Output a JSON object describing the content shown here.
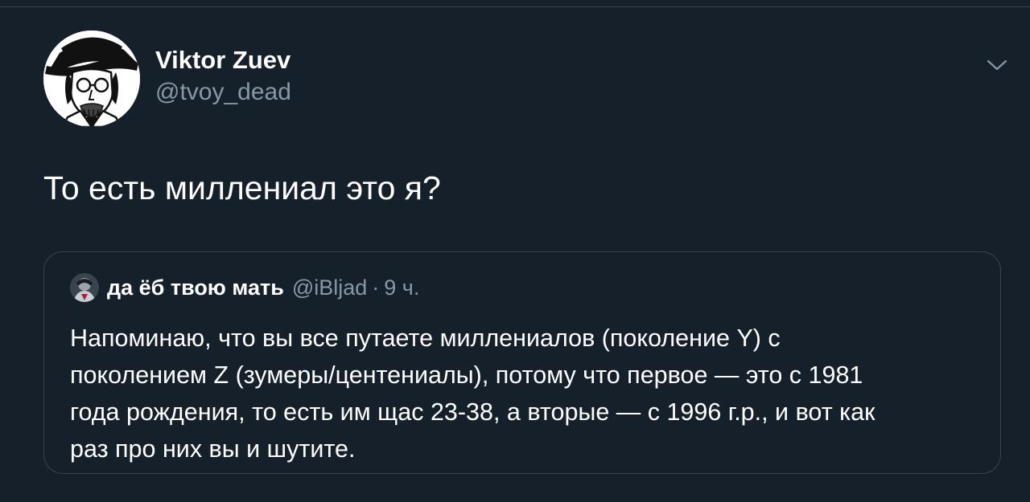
{
  "tweet": {
    "author": {
      "name": "Viktor Zuev",
      "handle": "@tvoy_dead",
      "avatar_icon": "avatar-illustration"
    },
    "text": "То есть миллениал это я?",
    "menu_icon": "chevron-down-icon",
    "quoted_tweet": {
      "author_name": "да ёб твою мать",
      "handle": "@iBljad",
      "separator": "·",
      "time": "9 ч.",
      "avatar_icon": "avatar-photo",
      "body_lines": [
        "Напоминаю, что вы все путаете миллениалов (поколение Y) с",
        "поколением Z (зумеры/центениалы), потому что первое — это с 1981",
        "года рождения, то есть им щас 23-38, а вторые — с 1996 г.р., и вот как",
        "раз про них вы и шутите."
      ]
    }
  },
  "colors": {
    "background": "#15202b",
    "border": "#38444d",
    "primary_text": "#ffffff",
    "secondary_text": "#8899a6"
  }
}
